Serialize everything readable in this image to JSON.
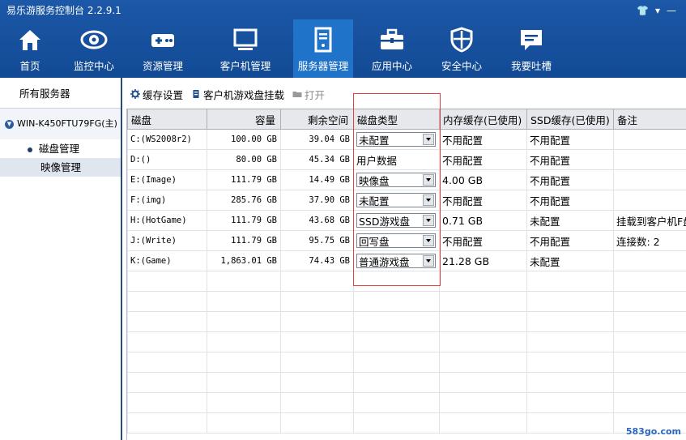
{
  "window": {
    "title": "易乐游服务控制台 2.2.9.1",
    "controls": [
      "👕",
      "▾",
      "—"
    ]
  },
  "nav": [
    {
      "label": "首页",
      "icon": "home-icon"
    },
    {
      "label": "监控中心",
      "icon": "eye-icon"
    },
    {
      "label": "资源管理",
      "icon": "gamepad-icon"
    },
    {
      "label": "客户机管理",
      "icon": "monitor-icon"
    },
    {
      "label": "服务器管理",
      "icon": "server-icon",
      "active": true
    },
    {
      "label": "应用中心",
      "icon": "toolbox-icon"
    },
    {
      "label": "安全中心",
      "icon": "shield-icon"
    },
    {
      "label": "我要吐槽",
      "icon": "message-icon"
    }
  ],
  "sidebar": {
    "title": "所有服务器",
    "server": "WIN-K450FTU79FG(主)",
    "items": [
      "磁盘管理",
      "映像管理"
    ]
  },
  "toolbar": {
    "cache": "缓存设置",
    "mount": "客户机游戏盘挂载",
    "open": "打开"
  },
  "table": {
    "headers": [
      "磁盘",
      "容量",
      "剩余空间",
      "磁盘类型",
      "内存缓存(已使用)",
      "SSD缓存(已使用)",
      "备注"
    ],
    "rows": [
      {
        "disk": "C:(WS2008r2)",
        "capacity": "100.00 GB",
        "free": "39.04 GB",
        "type": "未配置",
        "select": true,
        "mem": "不用配置",
        "ssd": "不用配置",
        "note": ""
      },
      {
        "disk": "D:()",
        "capacity": "80.00 GB",
        "free": "45.34 GB",
        "type": "用户数据",
        "select": false,
        "mem": "不用配置",
        "ssd": "不用配置",
        "note": ""
      },
      {
        "disk": "E:(Image)",
        "capacity": "111.79 GB",
        "free": "14.49 GB",
        "type": "映像盘",
        "select": true,
        "mem": "4.00 GB",
        "ssd": "不用配置",
        "note": ""
      },
      {
        "disk": "F:(img)",
        "capacity": "285.76 GB",
        "free": "37.90 GB",
        "type": "未配置",
        "select": true,
        "mem": "不用配置",
        "ssd": "不用配置",
        "note": ""
      },
      {
        "disk": "H:(HotGame)",
        "capacity": "111.79 GB",
        "free": "43.68 GB",
        "type": "SSD游戏盘",
        "select": true,
        "mem": "0.71 GB",
        "ssd": "未配置",
        "note": "挂载到客户机F盘"
      },
      {
        "disk": "J:(Write)",
        "capacity": "111.79 GB",
        "free": "95.75 GB",
        "type": "回写盘",
        "select": true,
        "mem": "不用配置",
        "ssd": "不用配置",
        "note": "连接数: 2"
      },
      {
        "disk": "K:(Game)",
        "capacity": "1,863.01 GB",
        "free": "74.43 GB",
        "type": "普通游戏盘",
        "select": true,
        "mem": "21.28 GB",
        "ssd": "未配置",
        "note": ""
      }
    ],
    "empty_rows": 8
  },
  "watermark": "583go.com"
}
